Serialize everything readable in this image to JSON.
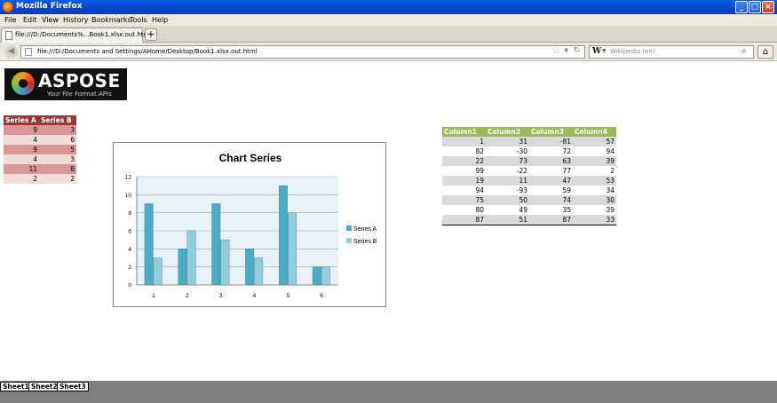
{
  "window": {
    "title": "Mozilla Firefox"
  },
  "menu": [
    "File",
    "Edit",
    "View",
    "History",
    "Bookmarks",
    "Tools",
    "Help"
  ],
  "tab": {
    "label": "file:///D:/Documents%...Book1.xlsx.out.html"
  },
  "nav": {
    "url": "file:///D:/Documents and Settings/AHome/Desktop/Book1.xlsx.out.html",
    "search_placeholder": "Wikipedia (en)"
  },
  "logo": {
    "brand": "ASPOSE",
    "tagline": "Your File Format APIs"
  },
  "left_table": {
    "headers": [
      "Series A",
      "Series B"
    ],
    "rows": [
      [
        9,
        3
      ],
      [
        4,
        6
      ],
      [
        9,
        5
      ],
      [
        4,
        3
      ],
      [
        11,
        8
      ],
      [
        2,
        2
      ]
    ]
  },
  "chart_data": {
    "type": "bar",
    "title": "Chart Series",
    "categories": [
      "1",
      "2",
      "3",
      "4",
      "5",
      "6"
    ],
    "series": [
      {
        "name": "Series A",
        "values": [
          9,
          4,
          9,
          4,
          11,
          2
        ],
        "color": "#4bacc6"
      },
      {
        "name": "Series B",
        "values": [
          3,
          6,
          5,
          3,
          8,
          2
        ],
        "color": "#93cddd"
      }
    ],
    "ylim": [
      0,
      12
    ],
    "yticks": [
      "0",
      "2",
      "4",
      "6",
      "8",
      "10",
      "12"
    ],
    "grid": true,
    "legend": "right"
  },
  "right_table": {
    "headers": [
      "Column1",
      "Column2",
      "Column3",
      "Column4"
    ],
    "rows": [
      [
        1,
        31,
        -81,
        57
      ],
      [
        82,
        -30,
        72,
        94
      ],
      [
        22,
        73,
        63,
        39
      ],
      [
        99,
        -22,
        77,
        2
      ],
      [
        19,
        11,
        47,
        53
      ],
      [
        94,
        -93,
        59,
        34
      ],
      [
        75,
        50,
        74,
        30
      ],
      [
        80,
        49,
        35,
        39
      ],
      [
        87,
        51,
        87,
        33
      ]
    ]
  },
  "sheets": [
    "Sheet1",
    "Sheet2",
    "Sheet3"
  ]
}
